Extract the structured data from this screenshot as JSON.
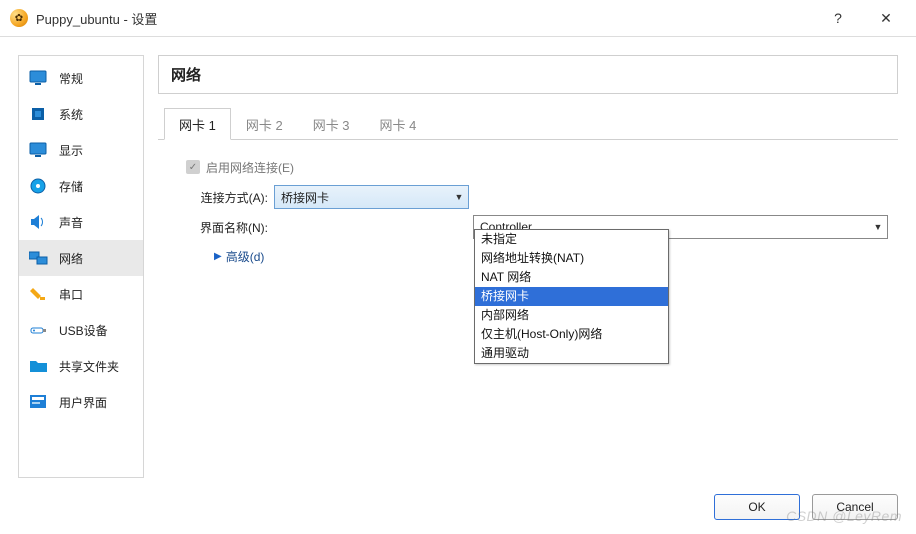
{
  "titlebar": {
    "title": "Puppy_ubuntu - 设置",
    "help": "?",
    "close": "✕"
  },
  "sidebar": {
    "items": [
      {
        "label": "常规",
        "icon": "monitor",
        "color": "#1E7FD6"
      },
      {
        "label": "系统",
        "icon": "chip",
        "color": "#0C5FB8"
      },
      {
        "label": "显示",
        "icon": "monitor",
        "color": "#0C88D6"
      },
      {
        "label": "存储",
        "icon": "disk",
        "color": "#17A2E8"
      },
      {
        "label": "声音",
        "icon": "speaker",
        "color": "#1E7FD6"
      },
      {
        "label": "网络",
        "icon": "net",
        "color": "#1E7FD6",
        "selected": true
      },
      {
        "label": "串口",
        "icon": "plug",
        "color": "#F4A816"
      },
      {
        "label": "USB设备",
        "icon": "usb",
        "color": "#1E7FD6"
      },
      {
        "label": "共享文件夹",
        "icon": "folder",
        "color": "#1490D8"
      },
      {
        "label": "用户界面",
        "icon": "ui",
        "color": "#1E7FD6"
      }
    ]
  },
  "header": {
    "title": "网络"
  },
  "tabs": [
    {
      "label": "网卡 1",
      "active": true
    },
    {
      "label": "网卡 2"
    },
    {
      "label": "网卡 3"
    },
    {
      "label": "网卡 4"
    }
  ],
  "form": {
    "enable_label": "启用网络连接(E)",
    "enabled": true,
    "attach_label": "连接方式(A):",
    "attach_value": "桥接网卡",
    "name_label": "界面名称(N):",
    "name_value": "Controller",
    "advanced_label": "高级(d)"
  },
  "dropdown": {
    "options": [
      "未指定",
      "网络地址转换(NAT)",
      "NAT 网络",
      "桥接网卡",
      "内部网络",
      "仅主机(Host-Only)网络",
      "通用驱动"
    ],
    "highlight_index": 3
  },
  "footer": {
    "ok": "OK",
    "cancel": "Cancel"
  },
  "watermark": "CSDN @LeyRem"
}
